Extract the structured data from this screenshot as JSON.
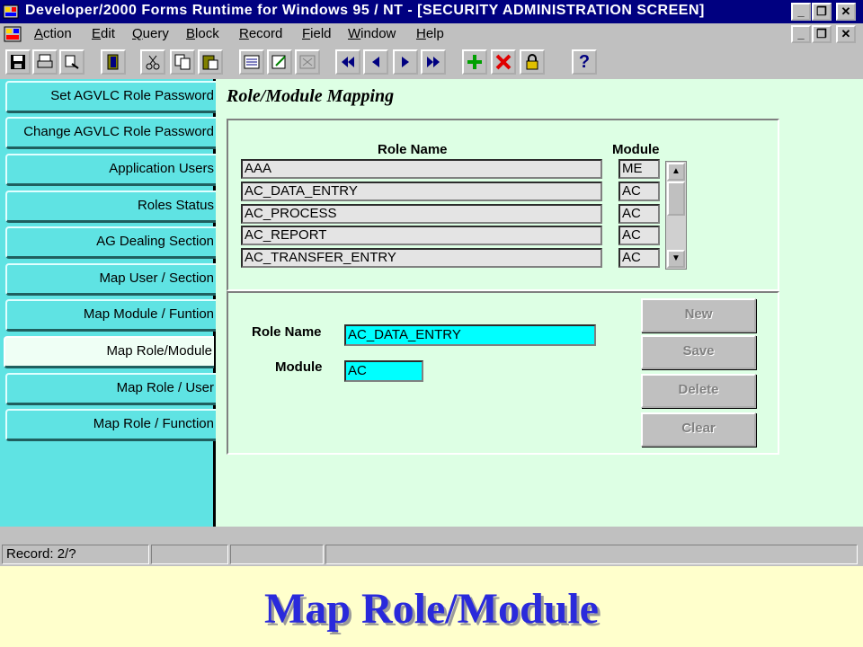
{
  "window": {
    "title": "Developer/2000 Forms Runtime for Windows 95 / NT - [SECURITY ADMINISTRATION SCREEN]"
  },
  "menu": [
    "Action",
    "Edit",
    "Query",
    "Block",
    "Record",
    "Field",
    "Window",
    "Help"
  ],
  "toolbar": {
    "icons": [
      "save-icon",
      "print-icon",
      "print-setup-icon",
      "exit-icon",
      "cut-icon",
      "copy-icon",
      "paste-icon",
      "list-of-values-icon",
      "edit-icon",
      "display-list-icon",
      "first-record-icon",
      "previous-record-icon",
      "next-record-icon",
      "last-record-icon",
      "insert-record-icon",
      "delete-record-icon",
      "lock-record-icon",
      "help-icon"
    ],
    "help_glyph": "?"
  },
  "sidebar": {
    "items": [
      {
        "label": "Set AGVLC Role Password"
      },
      {
        "label": "Change AGVLC Role Password"
      },
      {
        "label": "Application Users"
      },
      {
        "label": "Roles Status"
      },
      {
        "label": "AG Dealing Section"
      },
      {
        "label": "Map User / Section"
      },
      {
        "label": "Map Module / Funtion"
      },
      {
        "label": "Map Role/Module"
      },
      {
        "label": "Map Role / User"
      },
      {
        "label": "Map Role / Function"
      }
    ],
    "active_index": 7
  },
  "main": {
    "title": "Role/Module Mapping",
    "table": {
      "headers": {
        "role": "Role Name",
        "module": "Module"
      },
      "rows": [
        {
          "role": "AAA",
          "module": "ME"
        },
        {
          "role": "AC_DATA_ENTRY",
          "module": "AC"
        },
        {
          "role": "AC_PROCESS",
          "module": "AC"
        },
        {
          "role": "AC_REPORT",
          "module": "AC"
        },
        {
          "role": "AC_TRANSFER_ENTRY",
          "module": "AC"
        }
      ]
    },
    "form": {
      "role_label": "Role Name",
      "role_value": "AC_DATA_ENTRY",
      "module_label": "Module",
      "module_value": "AC"
    },
    "buttons": {
      "new": "New",
      "save": "Save",
      "delete": "Delete",
      "clear": "Clear"
    }
  },
  "status": {
    "record": "Record: 2/?"
  },
  "caption": "Map Role/Module",
  "colors": {
    "sidebar": "#5FE3E3",
    "main_bg": "#DDFFE4",
    "field_bg": "#00FFFF",
    "caption": "#2A2ADB",
    "titlebar": "#000080"
  }
}
